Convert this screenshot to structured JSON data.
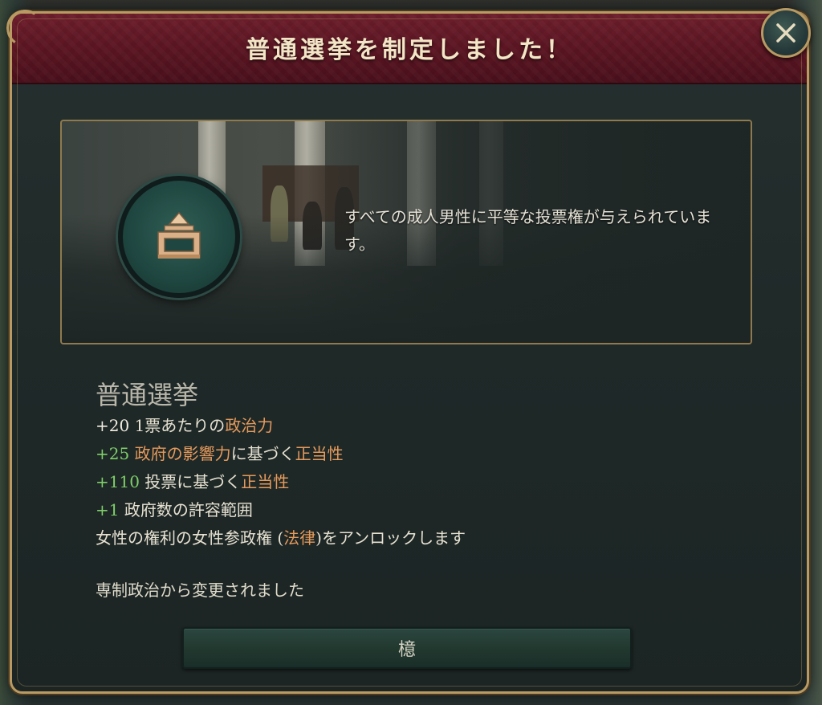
{
  "dialog": {
    "title": "普通選挙を制定しました！"
  },
  "banner": {
    "description": "すべての成人男性に平等な投票権が与えられています。"
  },
  "law": {
    "name": "普通選挙",
    "effects": [
      {
        "value": "+20",
        "label_plain": "1票あたりの",
        "label_highlight": "政治力"
      },
      {
        "value": "+25",
        "label_highlight_1": "政府の影響力",
        "label_plain": "に基づく",
        "label_highlight_2": "正当性"
      },
      {
        "value": "+110",
        "label_plain": "投票に基づく",
        "label_highlight": "正当性"
      },
      {
        "value": "+1",
        "label_plain": "政府数の許容範囲"
      }
    ],
    "unlock": {
      "prefix": "女性の権利の女性参政権 (",
      "highlight": "法律",
      "suffix": ")をアンロックします"
    },
    "changed_from": "専制政治から変更されました"
  },
  "buttons": {
    "ok_label": "檍"
  },
  "colors": {
    "header": "#5a1522",
    "gold_border": "#b89a62",
    "positive": "#7fcf6a",
    "highlight": "#e59a5c"
  },
  "icons": {
    "close": "close-icon",
    "emblem": "ballot-box-icon"
  }
}
